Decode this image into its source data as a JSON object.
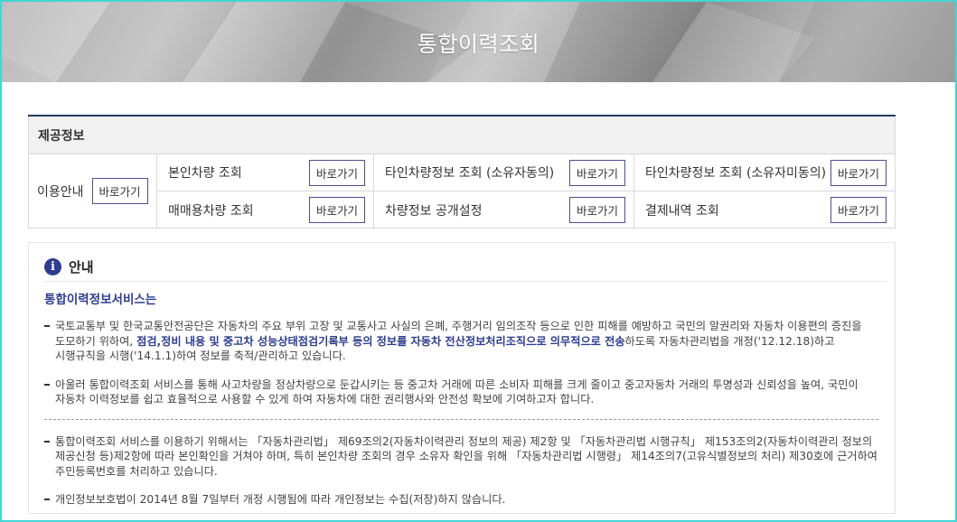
{
  "banner": {
    "title": "통합이력조회"
  },
  "provide": {
    "heading": "제공정보",
    "guide_label": "이용안내",
    "go_label": "바로가기",
    "items": [
      {
        "label": "본인차량 조회"
      },
      {
        "label": "타인차량정보 조회 (소유자동의)"
      },
      {
        "label": "타인차량정보 조회 (소유자미동의)"
      },
      {
        "label": "매매용차량 조회"
      },
      {
        "label": "차량정보 공개설정"
      },
      {
        "label": "결제내역 조회"
      }
    ]
  },
  "notice": {
    "title": "안내",
    "service_title": "통합이력정보서비스는",
    "p1_a": "국토교통부 및 한국교통안전공단은 자동차의 주요 부위 고장 및 교통사고 사실의 은폐, 주행거리 임의조작 등으로 인한 피해를 예방하고 국민의 알권리와 자동차 이용편의 증진을 도모하기 위하여, ",
    "p1_b": "점검,정비 내용 및 중고차 성능상태점검기록부 등의 정보를 자동차 전산정보처리조직으로 의무적으로 전송",
    "p1_c": "하도록 자동차관리법을 개정('12.12.18)하고 시행규칙을 시행('14.1.1)하여 정보를 축적/관리하고 있습니다.",
    "p2": "아울러 통합이력조회 서비스를 통해 사고차량을 정상차량으로 둔갑시키는 등 중고차 거래에 따른 소비자 피해를 크게 줄이고 중고자동차 거래의 투명성과 신뢰성을 높여, 국민이 자동차 이력정보를 쉽고 효율적으로 사용할 수 있게 하여 자동차에 대한 권리행사와 안전성 확보에 기여하고자 합니다.",
    "p3": "통합이력조회 서비스를 이용하기 위해서는 「자동차관리법」 제69조의2(자동차이력관리 정보의 제공) 제2항 및 「자동차관리법 시행규칙」 제153조의2(자동차이력관리 정보의 제공신청 등)제2항에 따라 본인확인을 거쳐야 하며, 특히 본인차량 조회의 경우 소유자 확인을 위해 「자동차관리법 시행령」 제14조의7(고유식별정보의 처리) 제30호에 근거하여 주민등록번호를 처리하고 있습니다.",
    "p4": "개인정보보호법이 2014년 8월 7일부터 개정 시행됨에 따라 개인정보는 수집(저장)하지 않습니다."
  }
}
